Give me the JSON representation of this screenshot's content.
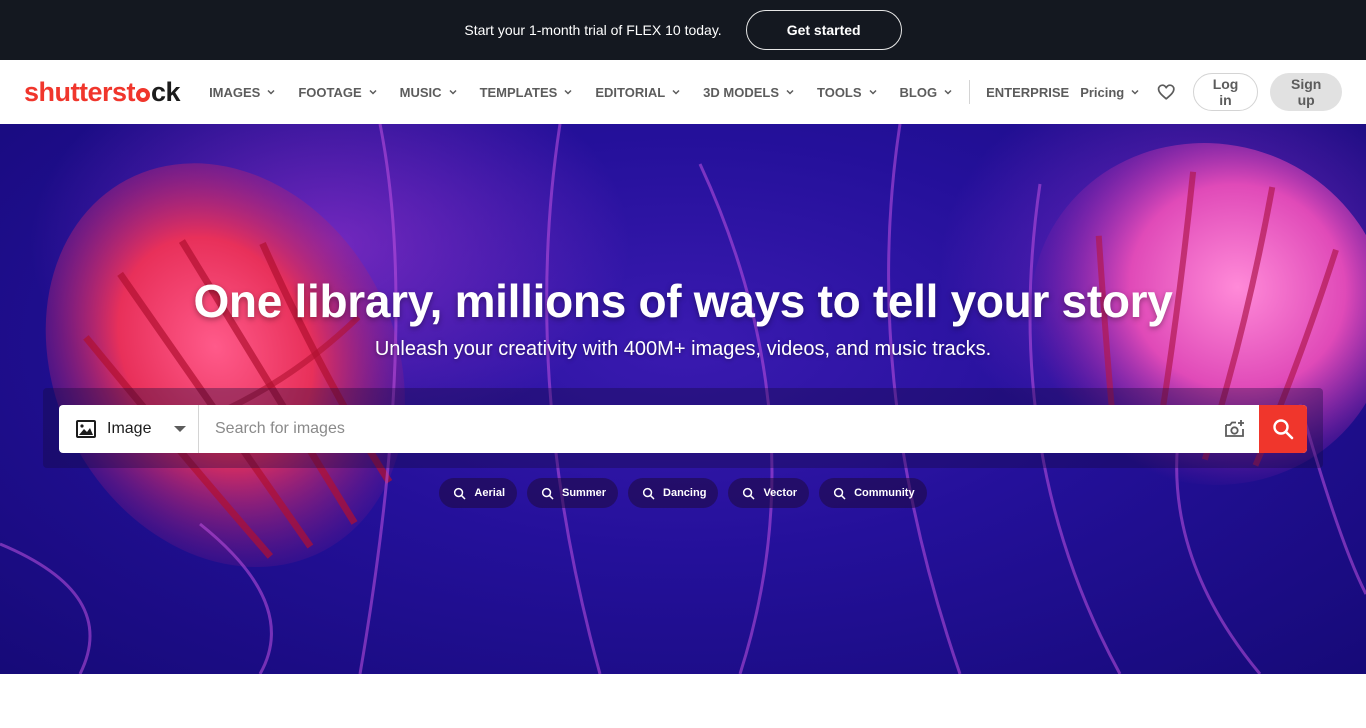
{
  "promo": {
    "text": "Start your 1-month trial of FLEX 10 today.",
    "cta": "Get started"
  },
  "nav": {
    "logo_main": "shutterst",
    "logo_tail": "ck",
    "items": [
      {
        "label": "IMAGES",
        "dropdown": true
      },
      {
        "label": "FOOTAGE",
        "dropdown": true
      },
      {
        "label": "MUSIC",
        "dropdown": true
      },
      {
        "label": "TEMPLATES",
        "dropdown": true
      },
      {
        "label": "EDITORIAL",
        "dropdown": true
      },
      {
        "label": "3D MODELS",
        "dropdown": true
      },
      {
        "label": "TOOLS",
        "dropdown": true
      },
      {
        "label": "BLOG",
        "dropdown": true
      }
    ],
    "enterprise": "ENTERPRISE",
    "pricing": "Pricing",
    "login": "Log in",
    "signup": "Sign up",
    "icons": {
      "favorites": "heart-icon",
      "dropdown": "chevron-down-icon"
    }
  },
  "hero": {
    "title": "One library, millions of ways to tell your story",
    "subtitle": "Unleash your creativity with 400M+ images, videos, and music tracks.",
    "search": {
      "type_label": "Image",
      "placeholder": "Search for images",
      "value": ""
    },
    "chips": [
      "Aerial",
      "Summer",
      "Dancing",
      "Vector",
      "Community"
    ]
  },
  "colors": {
    "brand": "#f0362c",
    "promo_bg": "#141820",
    "hero_bg": "#24109a"
  }
}
